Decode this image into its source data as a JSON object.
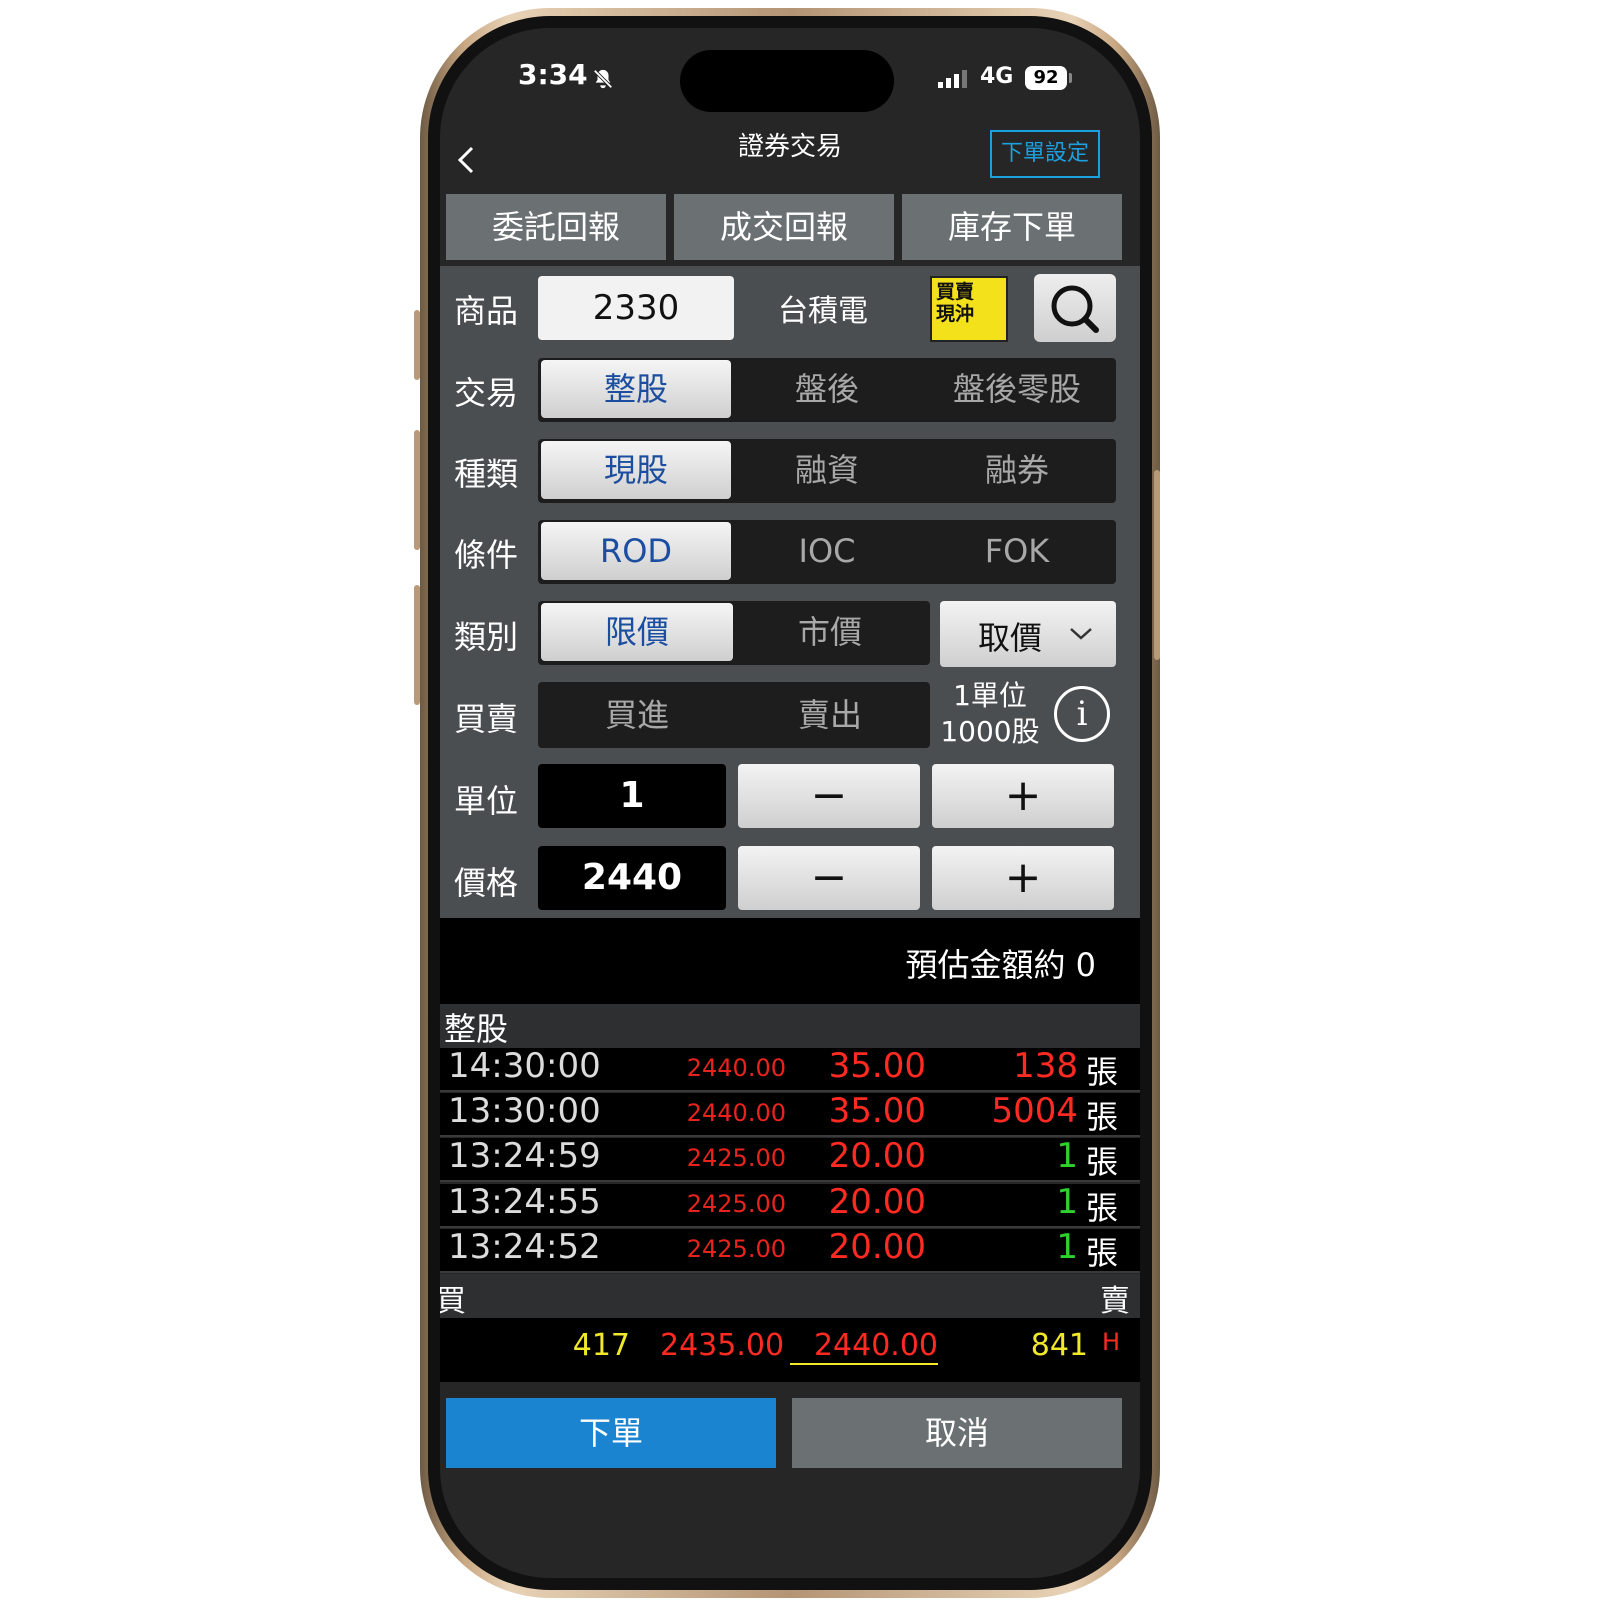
{
  "status_bar": {
    "time": "3:34",
    "network": "4G",
    "battery": "92"
  },
  "nav": {
    "title": "證券交易",
    "settings_label": "下單設定"
  },
  "tabs": [
    "委託回報",
    "成交回報",
    "庫存下單"
  ],
  "form": {
    "product": {
      "label": "商品",
      "code": "2330",
      "name": "台積電",
      "daytrade_badge": [
        "買賣",
        "現沖"
      ]
    },
    "trade": {
      "label": "交易",
      "options": [
        "整股",
        "盤後",
        "盤後零股"
      ],
      "selected": "整股"
    },
    "kind": {
      "label": "種類",
      "options": [
        "現股",
        "融資",
        "融券"
      ],
      "selected": "現股"
    },
    "condition": {
      "label": "條件",
      "options": [
        "ROD",
        "IOC",
        "FOK"
      ],
      "selected": "ROD"
    },
    "category": {
      "label": "類別",
      "options": [
        "限價",
        "市價"
      ],
      "selected": "限價",
      "price_picker": "取價"
    },
    "side": {
      "label": "買賣",
      "options": [
        "買進",
        "賣出"
      ],
      "unit_info": [
        "1單位",
        "1000股"
      ],
      "info_icon": "i"
    },
    "unit": {
      "label": "單位",
      "value": "1",
      "minus": "−",
      "plus": "+"
    },
    "price": {
      "label": "價格",
      "value": "2440",
      "minus": "−",
      "plus": "+"
    }
  },
  "estimate": "預估金額約 0",
  "ticks": {
    "title": "整股",
    "unit": "張",
    "rows": [
      {
        "time": "14:30:00",
        "price": "2440.00",
        "change": "35.00",
        "volume": "138",
        "vol_color": "#ff2a22"
      },
      {
        "time": "13:30:00",
        "price": "2440.00",
        "change": "35.00",
        "volume": "5004",
        "vol_color": "#ff2a22"
      },
      {
        "time": "13:24:59",
        "price": "2425.00",
        "change": "20.00",
        "volume": "1",
        "vol_color": "#2fd12f"
      },
      {
        "time": "13:24:55",
        "price": "2425.00",
        "change": "20.00",
        "volume": "1",
        "vol_color": "#2fd12f"
      },
      {
        "time": "13:24:52",
        "price": "2425.00",
        "change": "20.00",
        "volume": "1",
        "vol_color": "#2fd12f"
      }
    ]
  },
  "bidask": {
    "bid_label": "買",
    "ask_label": "賣",
    "bid_volume": "417",
    "bid_price": "2435.00",
    "ask_price": "2440.00",
    "ask_volume": "841",
    "flag": "H"
  },
  "actions": {
    "order": "下單",
    "cancel": "取消"
  },
  "colors": {
    "accent": "#1a84d0",
    "up": "#ff2a22",
    "down": "#2fd12f",
    "qty": "#f2e82a",
    "selected_text": "#1b4ea0"
  }
}
